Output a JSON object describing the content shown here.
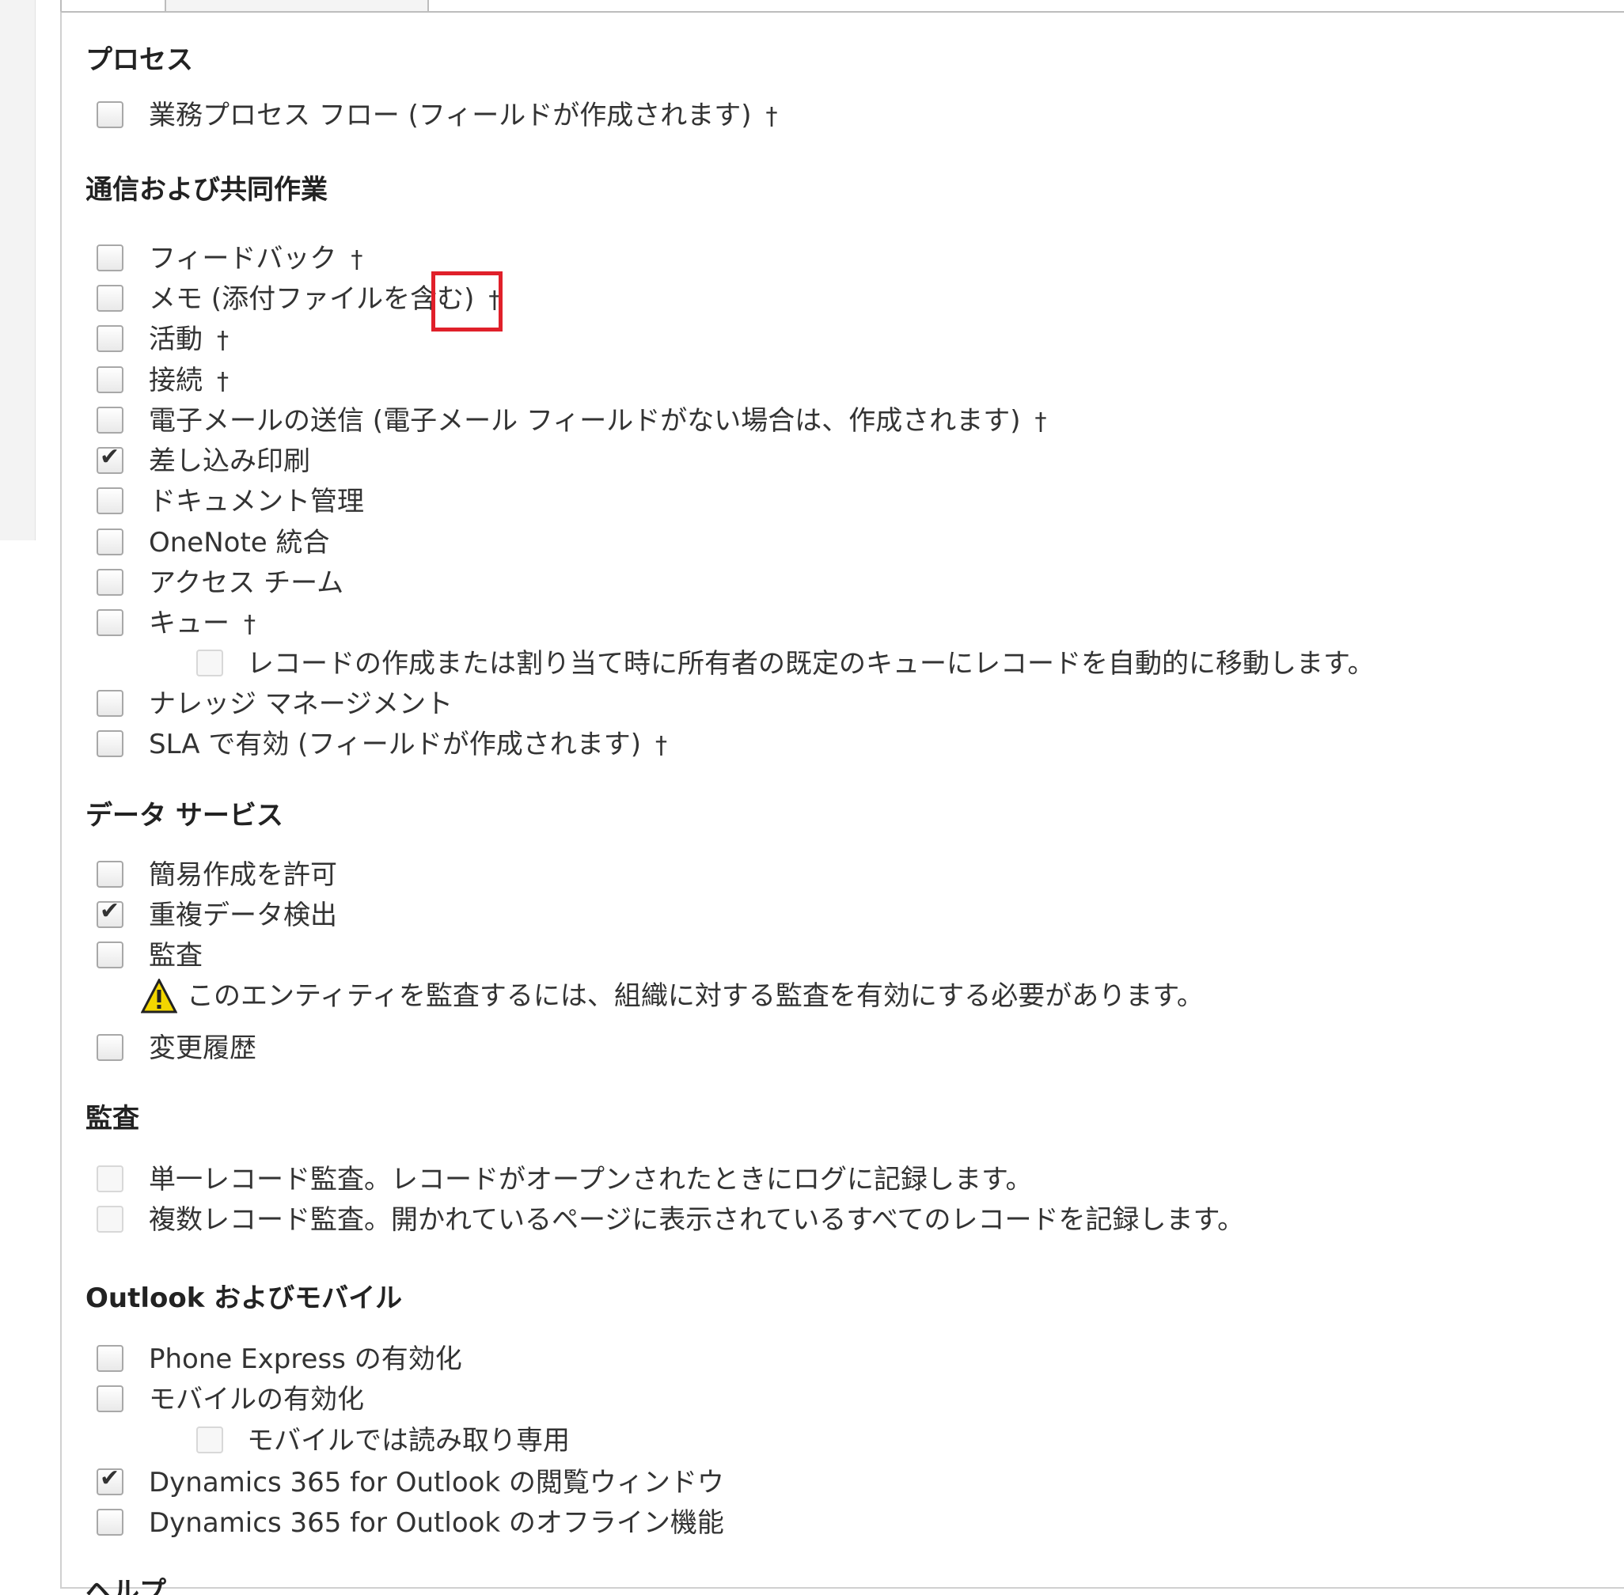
{
  "sections": {
    "process": "プロセス",
    "communication": "通信および共同作業",
    "data_services": "データ サービス",
    "auditing": "監査",
    "outlook_mobile": "Outlook およびモバイル",
    "help_partial": "ヘルプ"
  },
  "dagger": "†",
  "items": {
    "business_process_flow": "業務プロセス フロー (フィールドが作成されます)",
    "feedback": "フィードバック",
    "notes": "メモ (添付ファイルを含む)",
    "activities": "活動",
    "connections": "接続",
    "send_email": "電子メールの送信 (電子メール フィールドがない場合は、作成されます)",
    "mail_merge": "差し込み印刷",
    "document_management": "ドキュメント管理",
    "onenote": "OneNote 統合",
    "access_teams": "アクセス チーム",
    "queues": "キュー",
    "queue_auto_move": "レコードの作成または割り当て時に所有者の既定のキューにレコードを自動的に移動します。",
    "knowledge_management": "ナレッジ マネージメント",
    "sla": "SLA で有効 (フィールドが作成されます)",
    "quick_create": "簡易作成を許可",
    "duplicate_detection": "重複データ検出",
    "audit": "監査",
    "audit_warning": "このエンティティを監査するには、組織に対する監査を有効にする必要があります。",
    "change_tracking": "変更履歴",
    "single_record_audit": "単一レコード監査。レコードがオープンされたときにログに記録します。",
    "multiple_record_audit": "複数レコード監査。開かれているページに表示されているすべてのレコードを記録します。",
    "phone_express": "Phone Express の有効化",
    "mobile": "モバイルの有効化",
    "mobile_readonly": "モバイルでは読み取り専用",
    "outlook_reading_pane": "Dynamics 365 for Outlook の閲覧ウィンドウ",
    "outlook_offline": "Dynamics 365 for Outlook のオフライン機能"
  },
  "checked": {
    "mail_merge": true,
    "duplicate_detection": true,
    "outlook_reading_pane": true
  },
  "colors": {
    "highlight": "#e0202a",
    "warning": "#f2d600"
  }
}
